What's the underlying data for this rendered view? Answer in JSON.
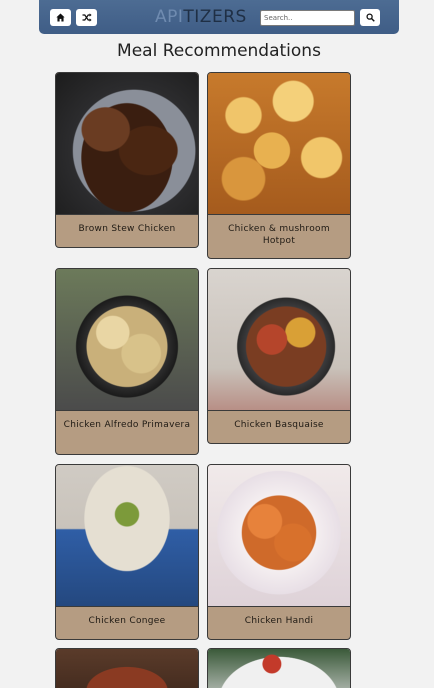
{
  "header": {
    "home_icon": "home-icon",
    "random_icon": "shuffle-icon",
    "logo_part1": "API",
    "logo_part2": "TIZERS",
    "search_placeholder": "Search..",
    "search_icon": "search-icon"
  },
  "page": {
    "title": "Meal Recommendations"
  },
  "meals": [
    {
      "name": "Brown Stew Chicken"
    },
    {
      "name": "Chicken & mushroom Hotpot"
    },
    {
      "name": "Chicken Alfredo Primavera"
    },
    {
      "name": "Chicken Basquaise"
    },
    {
      "name": "Chicken Congee"
    },
    {
      "name": "Chicken Handi"
    }
  ],
  "colors": {
    "header_bg": "#435f88",
    "card_bg": "#b59c82",
    "page_bg": "#f2f2f2"
  }
}
